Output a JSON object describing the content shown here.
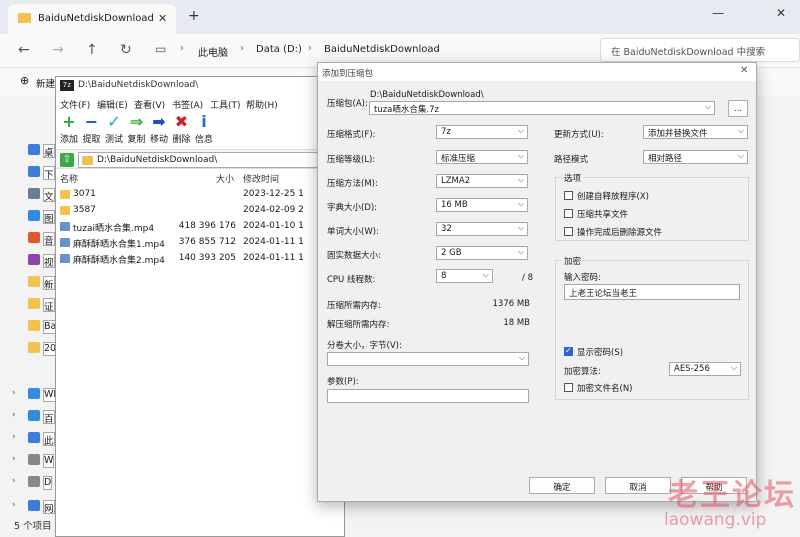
{
  "explorer": {
    "tab_title": "BaiduNetdiskDownload",
    "breadcrumbs": [
      "此电脑",
      "Data (D:)",
      "BaiduNetdiskDownload"
    ],
    "search_placeholder": "在 BaiduNetdiskDownload 中搜索",
    "new_label": "新建",
    "sidebar": [
      {
        "label": "桌",
        "color": "#3b7dd8"
      },
      {
        "label": "下",
        "color": "#3b7dd8"
      },
      {
        "label": "文",
        "color": "#6b7c93"
      },
      {
        "label": "图",
        "color": "#2f8ee0"
      },
      {
        "label": "音",
        "color": "#e4572e"
      },
      {
        "label": "视",
        "color": "#8e44ad"
      },
      {
        "label": "新",
        "color": "#f2c14e"
      },
      {
        "label": "证",
        "color": "#f2c14e"
      },
      {
        "label": "Ba",
        "color": "#f2c14e"
      },
      {
        "label": "20",
        "color": "#f2c14e"
      },
      {
        "label": "WI",
        "color": "#2f8ee0"
      },
      {
        "label": "百",
        "color": "#2f8ee0"
      },
      {
        "label": "此",
        "color": "#3b7dd8"
      },
      {
        "label": "W",
        "color": "#888"
      },
      {
        "label": "D",
        "color": "#888"
      },
      {
        "label": "网",
        "color": "#3b7dd8"
      }
    ],
    "status": "5 个项目"
  },
  "zfm": {
    "title": "D:\\BaiduNetdiskDownload\\",
    "menu": [
      "文件(F)",
      "编辑(E)",
      "查看(V)",
      "书签(A)",
      "工具(T)",
      "帮助(H)"
    ],
    "tools": [
      {
        "label": "添加",
        "glyph": "+",
        "color": "#2fa83a"
      },
      {
        "label": "提取",
        "glyph": "−",
        "color": "#1f4fbf"
      },
      {
        "label": "测试",
        "glyph": "✓",
        "color": "#1ca6b8"
      },
      {
        "label": "复制",
        "glyph": "⇒",
        "color": "#2fa83a"
      },
      {
        "label": "移动",
        "glyph": "➡",
        "color": "#1f4fbf"
      },
      {
        "label": "删除",
        "glyph": "✖",
        "color": "#d0202a"
      },
      {
        "label": "信息",
        "glyph": "i",
        "color": "#2a6ec8"
      }
    ],
    "path": "D:\\BaiduNetdiskDownload\\",
    "columns": {
      "name": "名称",
      "size": "大小",
      "modified": "修改时间"
    },
    "files": [
      {
        "name": "3071",
        "size": "",
        "date": "2023-12-25 1",
        "kind": "folder"
      },
      {
        "name": "3587",
        "size": "",
        "date": "2024-02-09 2",
        "kind": "folder"
      },
      {
        "name": "tuzai晒水合集.mp4",
        "size": "418 396 176",
        "date": "2024-01-10 1",
        "kind": "video"
      },
      {
        "name": "麻酥酥晒水合集1.mp4",
        "size": "376 855 712",
        "date": "2024-01-11 1",
        "kind": "video"
      },
      {
        "name": "麻酥酥晒水合集2.mp4",
        "size": "140 393 205",
        "date": "2024-01-11 1",
        "kind": "video"
      }
    ]
  },
  "dialog": {
    "title": "添加到压缩包",
    "archive_label": "压缩包(A):",
    "archive_dir": "D:\\BaiduNetdiskDownload\\",
    "archive_name": "tuza晒水合集.7z",
    "browse": "...",
    "format_label": "压缩格式(F):",
    "format_value": "7z",
    "level_label": "压缩等级(L):",
    "level_value": "标准压缩",
    "method_label": "压缩方法(M):",
    "method_value": "LZMA2",
    "dict_label": "字典大小(D):",
    "dict_value": "16 MB",
    "word_label": "单词大小(W):",
    "word_value": "32",
    "solid_label": "固实数据大小:",
    "solid_value": "2 GB",
    "threads_label": "CPU 线程数:",
    "threads_value": "8",
    "threads_max": "/ 8",
    "mem_comp_label": "压缩所需内存:",
    "mem_comp_value": "1376 MB",
    "mem_decomp_label": "解压缩所需内存:",
    "mem_decomp_value": "18 MB",
    "split_label": "分卷大小，字节(V):",
    "split_value": "",
    "params_label": "参数(P):",
    "params_value": "",
    "update_label": "更新方式(U):",
    "update_value": "添加并替换文件",
    "pathmode_label": "路径模式",
    "pathmode_value": "相对路径",
    "options_title": "选项",
    "opt_sfx": "创建自释放程序(X)",
    "opt_shared": "压缩共享文件",
    "opt_delete": "操作完成后删除源文件",
    "enc_title": "加密",
    "pwd_label": "输入密码:",
    "pwd_value": "上老王论坛当老王",
    "show_pwd": "显示密码(S)",
    "show_pwd_checked": true,
    "enc_method_label": "加密算法:",
    "enc_method_value": "AES-256",
    "enc_names": "加密文件名(N)",
    "ok": "确定",
    "cancel": "取消",
    "help": "帮助"
  },
  "watermark": {
    "line1": "老王论坛",
    "line2": "laowang.vip"
  }
}
